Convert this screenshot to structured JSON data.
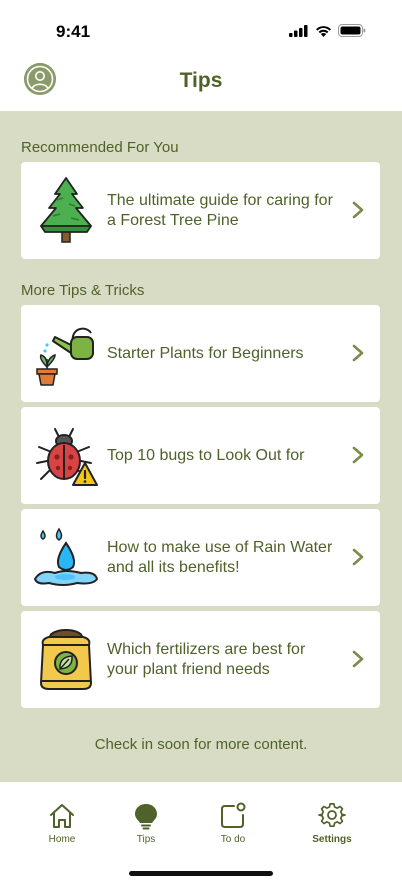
{
  "status": {
    "time": "9:41"
  },
  "header": {
    "title": "Tips"
  },
  "sections": {
    "recommended": "Recommended For You",
    "more": "More Tips & Tricks"
  },
  "cards": [
    {
      "title": "The ultimate guide for caring for a Forest Tree Pine",
      "icon": "pine-tree-icon"
    },
    {
      "title": "Starter Plants for Beginners",
      "icon": "watering-can-icon"
    },
    {
      "title": "Top 10 bugs to Look Out for",
      "icon": "bug-warning-icon"
    },
    {
      "title": "How to make use of Rain Water and all its benefits!",
      "icon": "water-drops-icon"
    },
    {
      "title": "Which fertilizers are best for your plant friend needs",
      "icon": "fertilizer-bag-icon"
    }
  ],
  "footer_note": "Check in soon for more content.",
  "tabs": [
    {
      "label": "Home",
      "icon": "home-icon"
    },
    {
      "label": "Tips",
      "icon": "lightbulb-icon"
    },
    {
      "label": "To do",
      "icon": "todo-icon"
    },
    {
      "label": "Settings",
      "icon": "gear-icon"
    }
  ],
  "colors": {
    "background": "#d8dcc5",
    "text": "#4f6229",
    "card": "#ffffff"
  }
}
